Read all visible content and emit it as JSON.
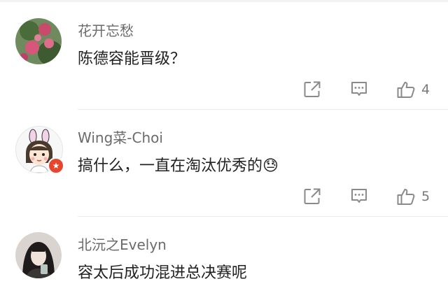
{
  "comments": [
    {
      "username": "花开忘愁",
      "text": "陈德容能晋级？",
      "likes": "4"
    },
    {
      "username": "Wing菜-Choi",
      "text": "搞什么，一直在淘汰优秀的",
      "emoji": "😓",
      "likes": "5",
      "badge_icon": "star-badge-icon"
    },
    {
      "username": "北沅之Evelyn",
      "text": "容太后成功混进总决赛呢"
    }
  ],
  "colors": {
    "username": "#6b6b6b",
    "text": "#222222",
    "icon": "#8a8a8a",
    "badge": "#e8452e"
  }
}
